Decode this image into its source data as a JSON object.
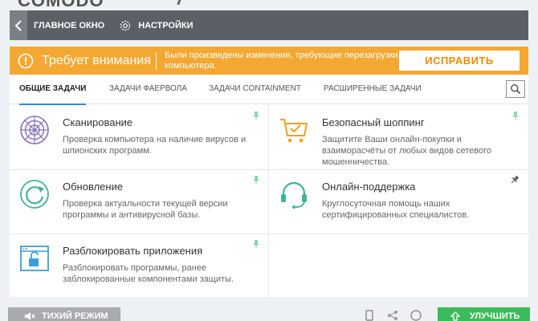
{
  "navbar": {
    "main_label": "ГЛАВНОЕ ОКНО",
    "settings_label": "НАСТРОЙКИ"
  },
  "alert": {
    "title": "Требует внимания",
    "message": "Были произведены изменения, требующие перезагрузки компьютера.",
    "fix_label": "ИСПРАВИТЬ"
  },
  "tabs": [
    {
      "label": "ОБЩИЕ ЗАДАЧИ"
    },
    {
      "label": "ЗАДАЧИ ФАЕРВОЛА"
    },
    {
      "label": "ЗАДАЧИ CONTAINMENT"
    },
    {
      "label": "РАСШИРЕННЫЕ ЗАДАЧИ"
    }
  ],
  "tasks": [
    {
      "title": "Сканирование",
      "desc": "Проверка компьютера на наличие вирусов и шпионских программ."
    },
    {
      "title": "Безопасный шоппинг",
      "desc": "Защитите Ваши онлайн-покупки и взаиморасчёты от любых видов сетевого мошенничества."
    },
    {
      "title": "Обновление",
      "desc": "Проверка актуальности текущей версии программы и антивирусной базы."
    },
    {
      "title": "Онлайн-поддержка",
      "desc": "Круглосуточная помощь наших сертифицированных специалистов."
    },
    {
      "title": "Разблокировать приложения",
      "desc": "Разблокировать программы, ранее заблокированные компонентами защиты."
    }
  ],
  "bottom": {
    "quiet_label": "ТИХИЙ РЕЖИМ",
    "upgrade_label": "УЛУЧШИТЬ"
  },
  "colors": {
    "alert": "#f3a833",
    "accent_blue": "#2d8ad8",
    "task_icon": "#3fb39a",
    "shopping_icon": "#f0a020",
    "upgrade": "#3cbb5a"
  }
}
